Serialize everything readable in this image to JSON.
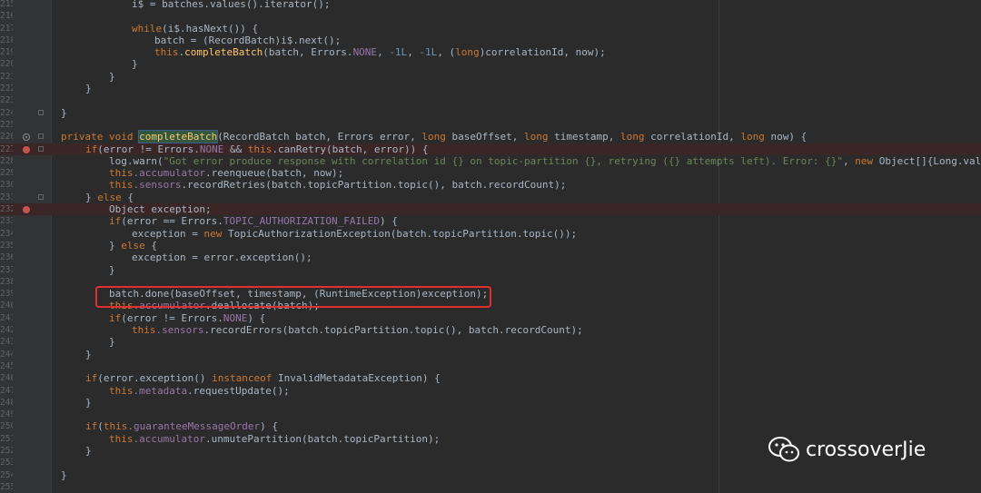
{
  "line_numbers": [
    "215",
    "216",
    "217",
    "218",
    "219",
    "220",
    "221",
    "222",
    "223",
    "224",
    "225",
    "226",
    "227",
    "228",
    "229",
    "230",
    "231",
    "232",
    "233",
    "234",
    "235",
    "236",
    "237",
    "238",
    "239",
    "240",
    "241",
    "242",
    "243",
    "244",
    "245",
    "246",
    "247",
    "248",
    "249",
    "250",
    "251",
    "252",
    "253",
    "254",
    "255"
  ],
  "code": {
    "l215": "i$ = batches.values().iterator();",
    "l217_while": "while",
    "l217_rest": "(i$.hasNext()) {",
    "l218": "batch = (RecordBatch)i$.next();",
    "l219_this": "this",
    "l219_dot": ".",
    "l219_call": "completeBatch",
    "l219_args1": "(batch, Errors.",
    "l219_none": "NONE",
    "l219_c1": ", ",
    "l219_n1": "-1L",
    "l219_c2": ", ",
    "l219_n2": "-1L",
    "l219_c3": ", (",
    "l219_long": "long",
    "l219_end": ")correlationId, now);",
    "l220": "}",
    "l221": "}",
    "l224": "}",
    "l226_priv": "private void ",
    "l226_name": "completeBatch",
    "l226_p1": "(RecordBatch batch, Errors error, ",
    "l226_long1": "long ",
    "l226_p2": "baseOffset, ",
    "l226_long2": "long ",
    "l226_p3": "timestamp, ",
    "l226_long3": "long ",
    "l226_p4": "correlationId, ",
    "l226_long4": "long ",
    "l226_p5": "now) {",
    "l227_if": "if",
    "l227_a": "(error != Errors.",
    "l227_none": "NONE",
    "l227_b": " && ",
    "l227_this": "this",
    "l227_c": ".canRetry(batch, error)) {",
    "l228_a": "log.warn(",
    "l228_str": "\"Got error produce response with correlation id {} on topic-partition {}, retrying ({} attempts left). Error: {}\"",
    "l228_b": ", ",
    "l228_new": "new ",
    "l228_c": "Object[]{Long.valueOf(corr",
    "l229_this": "this",
    "l229_f": ".accumulator",
    "l229_rest": ".reenqueue(batch, now);",
    "l230_this": "this",
    "l230_f": ".sensors",
    "l230_rest": ".recordRetries(batch.topicPartition.topic(), batch.recordCount);",
    "l231_a": "} ",
    "l231_else": "else",
    "l231_b": " {",
    "l232": "Object exception;",
    "l233_if": "if",
    "l233_a": "(error == Errors.",
    "l233_c": "TOPIC_AUTHORIZATION_FAILED",
    "l233_b": ") {",
    "l234_a": "exception = ",
    "l234_new": "new ",
    "l234_b": "TopicAuthorizationException(batch.topicPartition.topic());",
    "l235_a": "} ",
    "l235_else": "else",
    "l235_b": " {",
    "l236": "exception = error.exception();",
    "l237": "}",
    "l239": "batch.done(baseOffset, timestamp, (RuntimeException)exception);",
    "l240_this": "this",
    "l240_f": ".accumulator",
    "l240_rest": ".deallocate(batch);",
    "l241_if": "if",
    "l241_a": "(error != Errors.",
    "l241_none": "NONE",
    "l241_b": ") {",
    "l242_this": "this",
    "l242_f": ".sensors",
    "l242_rest": ".recordErrors(batch.topicPartition.topic(), batch.recordCount);",
    "l243": "}",
    "l244": "}",
    "l246_if": "if",
    "l246_a": "(error.exception() ",
    "l246_inst": "instanceof",
    "l246_b": " InvalidMetadataException) {",
    "l247_this": "this",
    "l247_f": ".metadata",
    "l247_rest": ".requestUpdate();",
    "l248": "}",
    "l250_if": "if",
    "l250_a": "(",
    "l250_this": "this",
    "l250_f": ".guaranteeMessageOrder",
    "l250_b": ") {",
    "l251_this": "this",
    "l251_f": ".accumulator",
    "l251_rest": ".unmutePartition(batch.topicPartition);",
    "l252": "}",
    "l254": "}"
  },
  "watermark": {
    "text": "crossoverJie",
    "icon": "wechat-icon"
  },
  "colors": {
    "keyword": "#cc7832",
    "field": "#9876aa",
    "method": "#ffc66d",
    "number": "#6897bb",
    "string": "#6a8759",
    "plain": "#a9b7c6",
    "annotation_box": "#e03030",
    "breakpoint": "#c75450"
  }
}
